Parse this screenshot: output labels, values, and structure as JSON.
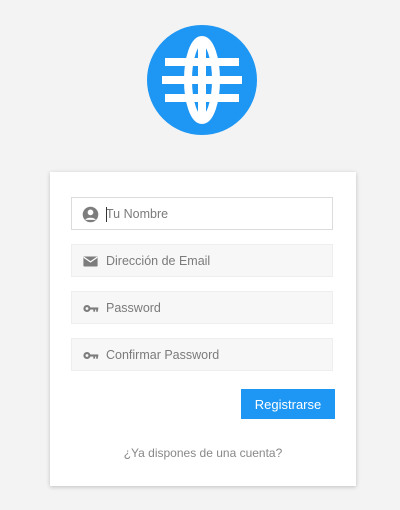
{
  "brand": {
    "logo_icon": "globe-icon",
    "accent_color": "#1e96f3"
  },
  "form": {
    "name": {
      "icon": "user-circle-icon",
      "placeholder": "Tu Nombre",
      "value": ""
    },
    "email": {
      "icon": "envelope-icon",
      "placeholder": "Dirección de Email",
      "value": ""
    },
    "password": {
      "icon": "key-icon",
      "placeholder": "Password",
      "value": ""
    },
    "confirm_password": {
      "icon": "key-icon",
      "placeholder": "Confirmar Password",
      "value": ""
    },
    "submit_label": "Registrarse",
    "login_link": "¿Ya dispones de una cuenta?"
  }
}
